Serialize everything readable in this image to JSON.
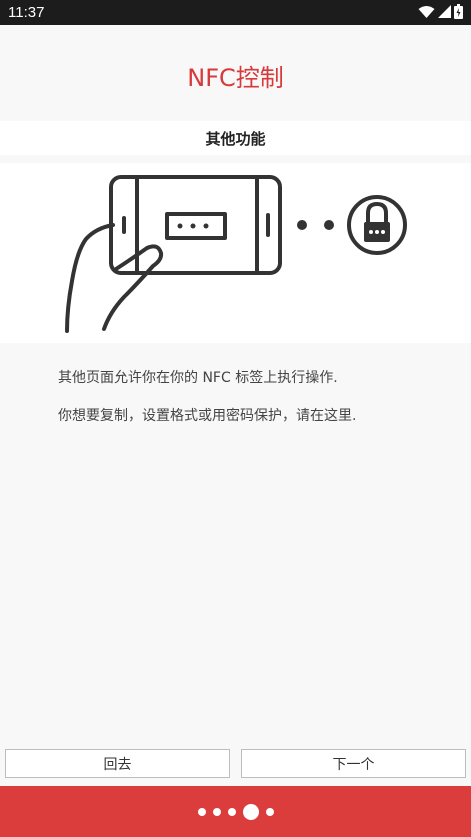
{
  "status_bar": {
    "time": "11:37",
    "icons": [
      "wifi-icon",
      "signal-icon",
      "battery-icon"
    ]
  },
  "header": {
    "title": "NFC控制"
  },
  "section": {
    "title": "其他功能"
  },
  "illustration": {
    "icons": [
      "hand-phone-icon",
      "password-field-icon",
      "lock-icon"
    ]
  },
  "description": {
    "line1": "其他页面允许你在你的 NFC 标签上执行操作.",
    "line2": "你想要复制，设置格式或用密码保护，请在这里."
  },
  "buttons": {
    "back": "回去",
    "next": "下一个"
  },
  "pager": {
    "total": 5,
    "current": 4
  },
  "colors": {
    "accent": "#db3d3d",
    "title": "#d63a3a"
  }
}
